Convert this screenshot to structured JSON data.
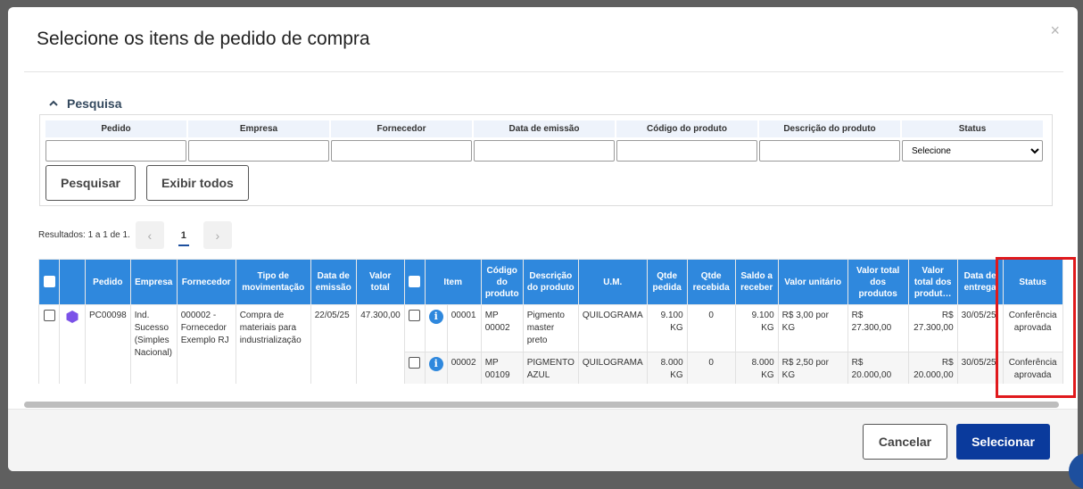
{
  "modal": {
    "title": "Selecione os itens de pedido de compra",
    "close_label": "×"
  },
  "search": {
    "header": "Pesquisa",
    "filters": [
      {
        "label": "Pedido",
        "value": ""
      },
      {
        "label": "Empresa",
        "value": ""
      },
      {
        "label": "Fornecedor",
        "value": ""
      },
      {
        "label": "Data de emissão",
        "value": ""
      },
      {
        "label": "Código do produto",
        "value": ""
      },
      {
        "label": "Descrição do produto",
        "value": ""
      }
    ],
    "status_label": "Status",
    "status_selected": "Selecione",
    "search_button": "Pesquisar",
    "show_all_button": "Exibir todos"
  },
  "results": {
    "text": "Resultados: 1 a 1 de 1.",
    "prev": "‹",
    "next": "›",
    "page": "1"
  },
  "table": {
    "headers": {
      "pedido": "Pedido",
      "empresa": "Empresa",
      "fornecedor": "Fornecedor",
      "tipo": "Tipo de movimentação",
      "data_emissao": "Data de emissão",
      "valor_total": "Valor total",
      "item": "Item",
      "codigo": "Código do produto",
      "descricao": "Descrição do produto",
      "um": "U.M.",
      "qtde_pedida": "Qtde pedida",
      "qtde_recebida": "Qtde recebida",
      "saldo": "Saldo a receber",
      "valor_unitario": "Valor unitário",
      "valor_total_produtos": "Valor total dos produtos",
      "valor_total_dos_produt": "Valor total dos produt…",
      "data_entrega": "Data de entrega",
      "status": "Status"
    },
    "order": {
      "pedido": "PC00098",
      "empresa": "Ind. Sucesso (Simples Nacional)",
      "fornecedor": "000002 - Fornecedor Exemplo RJ",
      "tipo": "Compra de materiais para industrialização",
      "data_emissao": "22/05/25",
      "valor_total": "47.300,00"
    },
    "items": [
      {
        "item": "00001",
        "codigo": "MP 00002",
        "descricao": "Pigmento master preto",
        "um": "QUILOGRAMA",
        "qtde_pedida": "9.100 KG",
        "qtde_recebida": "0",
        "saldo": "9.100 KG",
        "valor_unitario": "R$ 3,00 por KG",
        "valor_total_produtos": "R$ 27.300,00",
        "valor_total_dos_produt": "R$ 27.300,00",
        "data_entrega": "30/05/25",
        "status": "Conferência aprovada"
      },
      {
        "item": "00002",
        "codigo": "MP 00109",
        "descricao": "PIGMENTO AZUL",
        "um": "QUILOGRAMA",
        "qtde_pedida": "8.000 KG",
        "qtde_recebida": "0",
        "saldo": "8.000 KG",
        "valor_unitario": "R$ 2,50 por KG",
        "valor_total_produtos": "R$ 20.000,00",
        "valor_total_dos_produt": "R$ 20.000,00",
        "data_entrega": "30/05/25",
        "status": "Conferência aprovada"
      }
    ]
  },
  "footer": {
    "cancel": "Cancelar",
    "select": "Selecionar"
  },
  "colors": {
    "header_blue": "#2f88dd",
    "primary": "#0a3a9c",
    "highlight": "#e0191c",
    "status_icon": "#7b52e8"
  },
  "icons": {
    "collapse": "chevron-up-icon",
    "order_status": "hexagon-icon",
    "info": "info-icon"
  }
}
